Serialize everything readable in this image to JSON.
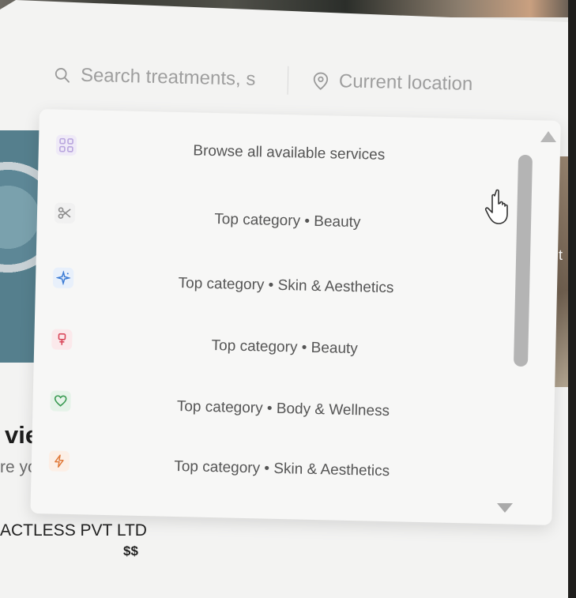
{
  "background": {
    "vendor_title": "vie",
    "vendor_subtitle": "re yo",
    "company": "ACTLESS PVT LTD",
    "price": "$$",
    "right_card_text": "d t"
  },
  "search": {
    "placeholder": "Search treatments, s",
    "location_placeholder": "Current location"
  },
  "dropdown": {
    "items": [
      {
        "label": "Browse all available services",
        "icon": "grid-icon",
        "icon_color": "#c9b8e6"
      },
      {
        "label": "Top category • Beauty",
        "icon": "scissors-icon",
        "icon_color": "#8c8c8c"
      },
      {
        "label": "Top category • Skin & Aesthetics",
        "icon": "sparkles-icon",
        "icon_color": "#3b7bd4"
      },
      {
        "label": "Top category • Beauty",
        "icon": "nail-polish-icon",
        "icon_color": "#d9475a"
      },
      {
        "label": "Top category • Body & Wellness",
        "icon": "heart-icon",
        "icon_color": "#3a9a52"
      },
      {
        "label": "Top category • Skin & Aesthetics",
        "icon": "zap-icon",
        "icon_color": "#e07a3a"
      }
    ]
  }
}
